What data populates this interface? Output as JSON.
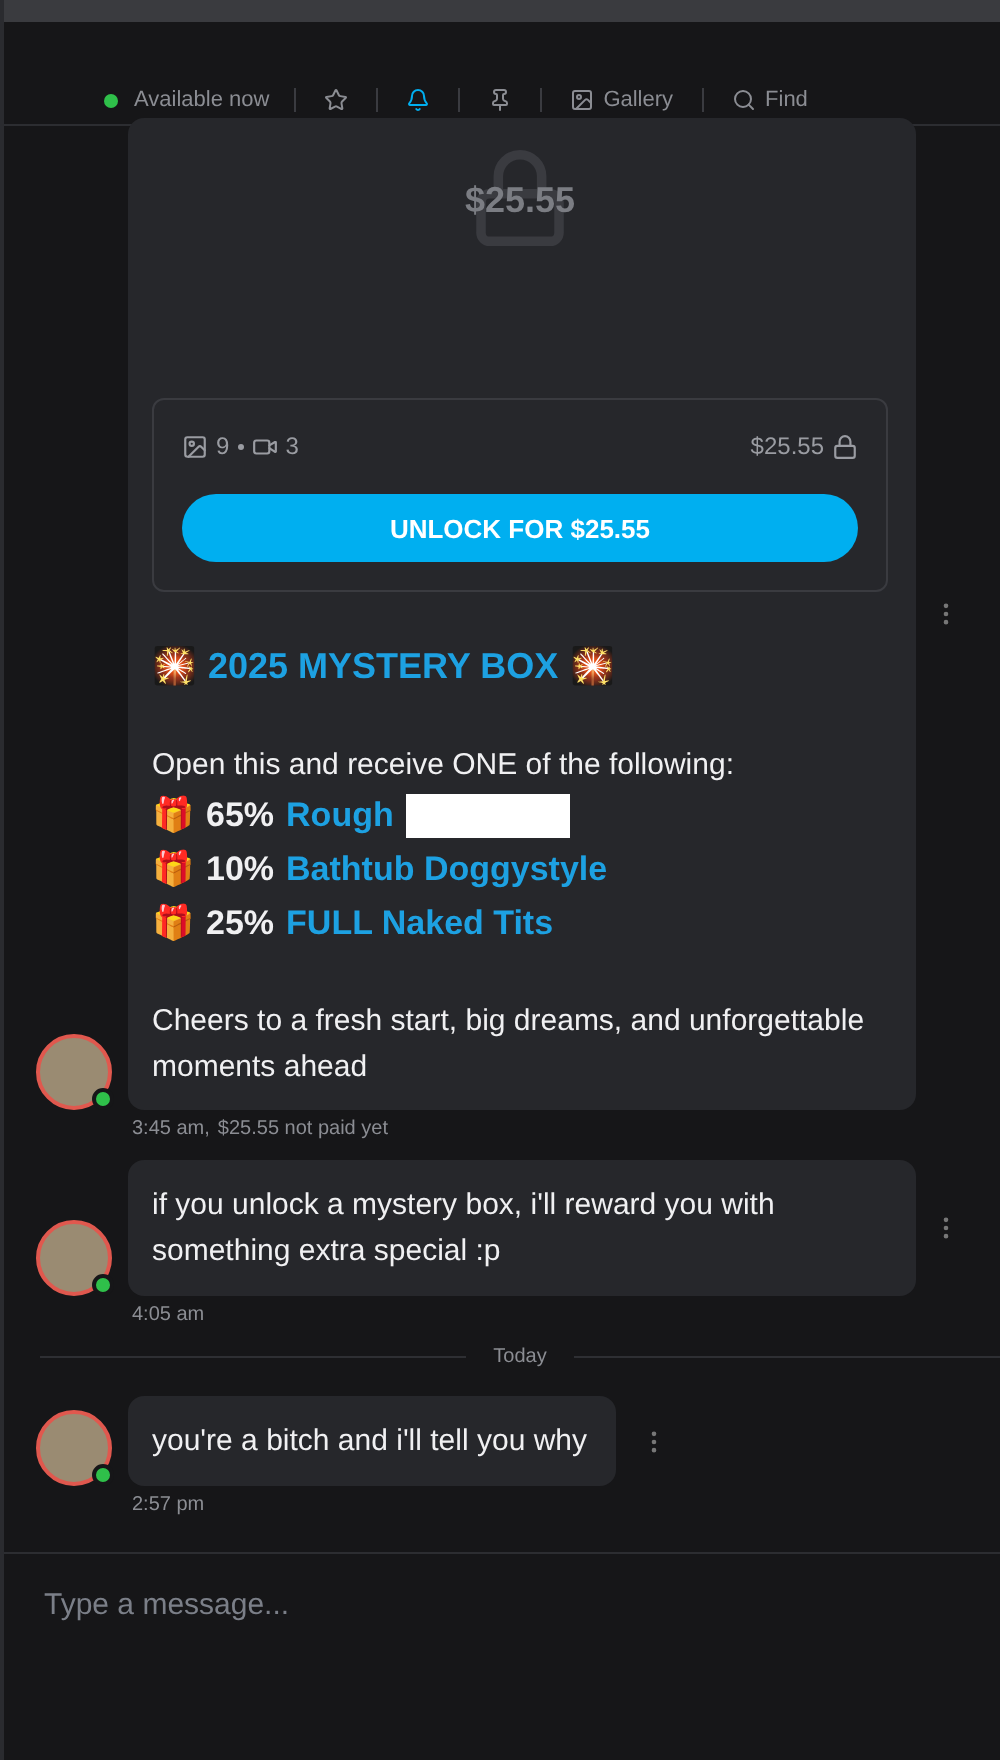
{
  "header": {
    "status": "Available now",
    "online": true,
    "actions": [
      {
        "kind": "star",
        "selected": false
      },
      {
        "kind": "bell",
        "selected": true
      },
      {
        "kind": "pin",
        "selected": false
      },
      {
        "kind": "gallery",
        "label": "Gallery",
        "selected": false
      },
      {
        "kind": "find",
        "label": "Find",
        "selected": false
      }
    ]
  },
  "messages": [
    {
      "kind": "ppv",
      "online": true,
      "locked_price": "$25.55",
      "photos": "9",
      "videos": "3",
      "price": "$25.55",
      "button": "UNLOCK FOR $25.55",
      "title": {
        "lead": "🎇",
        "text": "2025 MYSTERY BOX",
        "trail": "🎇"
      },
      "intro": "Open this and receive ONE of the following:",
      "items": [
        {
          "icon": "🎁",
          "percent": "65%",
          "label": "Rough",
          "redacted": true
        },
        {
          "icon": "🎁",
          "percent": "10%",
          "label": "Bathtub Doggystyle",
          "redacted": false
        },
        {
          "icon": "🎁",
          "percent": "25%",
          "label": "FULL Naked Tits",
          "redacted": false
        }
      ],
      "text": "Cheers to a fresh start, big dreams, and unforgettable moments ahead",
      "time": "3:45 am,",
      "note": "$25.55 not paid yet"
    },
    {
      "kind": "text",
      "online": true,
      "text": "if you unlock a mystery box, i'll reward you with something extra special :p",
      "time": "4:05 am",
      "short": false
    },
    {
      "kind": "divider",
      "label": "Today"
    },
    {
      "kind": "text",
      "online": true,
      "text": "you're a bitch and i'll tell you why",
      "time": "2:57 pm",
      "short": true
    }
  ],
  "composer": {
    "placeholder": "Type a message..."
  }
}
